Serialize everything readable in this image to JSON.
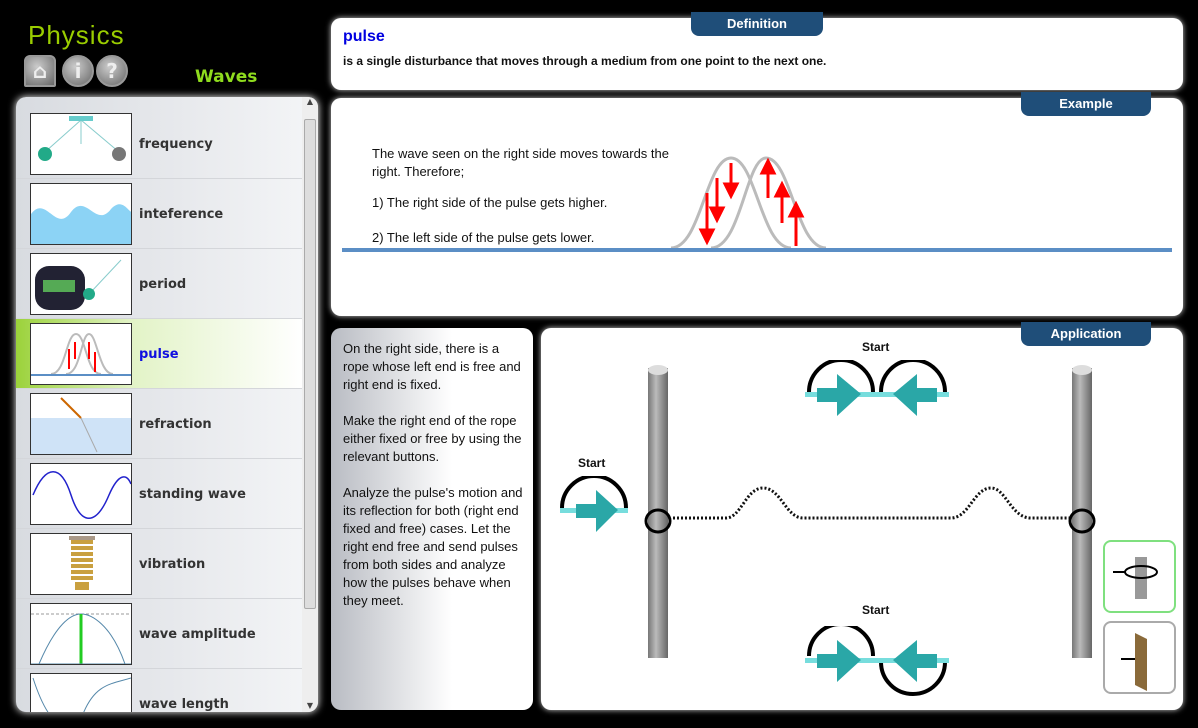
{
  "app": {
    "logo": "Physics",
    "section": "Waves",
    "nav": [
      {
        "icon": "home-icon"
      },
      {
        "icon": "info-icon"
      },
      {
        "icon": "help-icon"
      }
    ]
  },
  "topics": [
    {
      "label": "frequency"
    },
    {
      "label": "inteference"
    },
    {
      "label": "period"
    },
    {
      "label": "pulse",
      "selected": true
    },
    {
      "label": "refraction"
    },
    {
      "label": "standing wave"
    },
    {
      "label": "vibration"
    },
    {
      "label": "wave amplitude"
    },
    {
      "label": "wave length"
    }
  ],
  "definition": {
    "tab": "Definition",
    "term": "pulse",
    "text": "is a single disturbance that moves through a medium from one point to the next one."
  },
  "example": {
    "tab": "Example",
    "lines": [
      "The wave seen on the right side moves towards the right. Therefore;",
      "1) The right side of the pulse gets higher.",
      "2) The left side of the pulse gets lower."
    ]
  },
  "instructions": [
    "On the right side, there is a rope whose left end is free and right end is fixed.",
    "Make the right end of the rope either fixed or free by using the relevant buttons.",
    "Analyze the pulse's motion and its reflection for both (right end fixed and free) cases. Let the right end free and send pulses from both sides and analyze how the pulses behave when they meet."
  ],
  "application": {
    "tab": "Application",
    "start_left": "Start",
    "start_top": "Start",
    "start_bottom": "Start"
  },
  "colors": {
    "accent": "#1f4e79",
    "selected": "#9bd23a",
    "arrow": "#2aa7a7"
  }
}
